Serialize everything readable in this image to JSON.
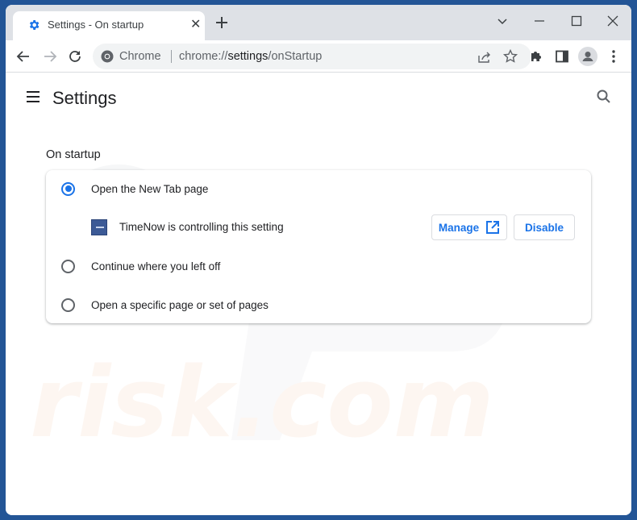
{
  "browser": {
    "tab": {
      "title": "Settings - On startup",
      "icon": "gear-icon"
    },
    "omnibox": {
      "label": "Chrome",
      "url_prefix": "chrome://",
      "url_host": "settings",
      "url_path": "/onStartup"
    }
  },
  "settings": {
    "title": "Settings",
    "section_title": "On startup",
    "options": [
      {
        "label": "Open the New Tab page",
        "selected": true
      },
      {
        "label": "Continue where you left off",
        "selected": false
      },
      {
        "label": "Open a specific page or set of pages",
        "selected": false
      }
    ],
    "extension_notice": {
      "text": "TimeNow is controlling this setting",
      "manage_label": "Manage",
      "disable_label": "Disable"
    }
  },
  "colors": {
    "accent": "#1a73e8",
    "frame": "#235596",
    "tabstrip": "#dee1e6"
  }
}
